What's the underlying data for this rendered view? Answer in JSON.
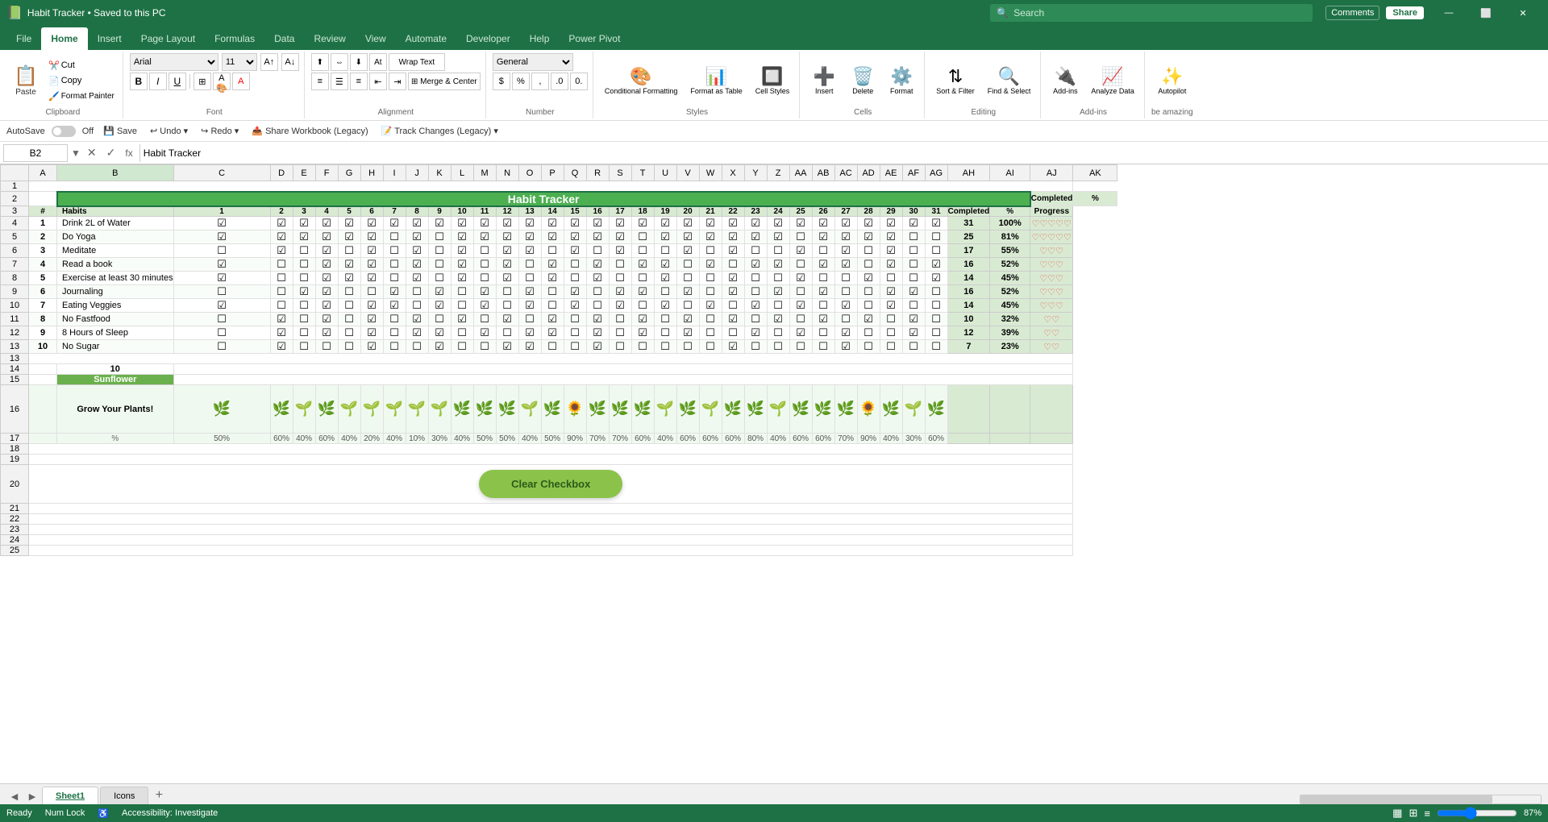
{
  "app": {
    "title": "Habit Tracker • Saved to this PC",
    "icon": "📊"
  },
  "titlebar": {
    "search_placeholder": "Search",
    "minimize": "—",
    "maximize": "⬜",
    "close": "✕",
    "comments": "Comments",
    "share": "Share"
  },
  "ribbon": {
    "tabs": [
      "File",
      "Home",
      "Insert",
      "Page Layout",
      "Formulas",
      "Data",
      "Review",
      "View",
      "Automate",
      "Developer",
      "Help",
      "Power Pivot"
    ],
    "active_tab": "Home",
    "groups": {
      "clipboard": "Clipboard",
      "font": "Font",
      "alignment": "Alignment",
      "number": "Number",
      "styles": "Styles",
      "cells": "Cells",
      "editing": "Editing",
      "addins": "Add-ins",
      "beamazing": "be amazing"
    },
    "buttons": {
      "paste": "Paste",
      "cut": "Cut",
      "copy": "Copy",
      "format_painter": "Format Painter",
      "bold": "B",
      "italic": "I",
      "underline": "U",
      "font_name": "Arial",
      "font_size": "11",
      "wrap_text": "Wrap Text",
      "merge_center": "Merge & Center",
      "conditional_formatting": "Conditional Formatting",
      "format_as_table": "Format as Table",
      "cell_styles": "Cell Styles",
      "insert": "Insert",
      "delete": "Delete",
      "format": "Format",
      "sort_filter": "Sort & Filter",
      "find_select": "Find & Select",
      "add_ins": "Add-ins",
      "analyze_data": "Analyze Data",
      "autopilot": "Autopilot"
    }
  },
  "quick_access": {
    "autosave": "AutoSave",
    "autosave_state": "Off",
    "save": "Save",
    "undo": "Undo",
    "redo": "Redo",
    "share_workbook": "Share Workbook (Legacy)",
    "track_changes": "Track Changes (Legacy)"
  },
  "formula_bar": {
    "cell_ref": "B2",
    "formula": "Habit Tracker"
  },
  "columns": [
    "",
    "A",
    "B",
    "C",
    "D",
    "E",
    "F",
    "G",
    "H",
    "I",
    "J",
    "K",
    "L",
    "M",
    "N",
    "O",
    "P",
    "Q",
    "R",
    "S",
    "T",
    "U",
    "V",
    "W",
    "X",
    "Y",
    "Z",
    "AA",
    "AB",
    "AC",
    "AD",
    "AE",
    "AF",
    "AG",
    "AH",
    "AI",
    "AJ",
    "AK"
  ],
  "tracker": {
    "title": "Habit Tracker",
    "column_headers": [
      "#",
      "Habits",
      "1",
      "2",
      "3",
      "4",
      "5",
      "6",
      "7",
      "8",
      "9",
      "10",
      "11",
      "12",
      "13",
      "14",
      "15",
      "16",
      "17",
      "18",
      "19",
      "20",
      "21",
      "22",
      "23",
      "24",
      "25",
      "26",
      "27",
      "28",
      "29",
      "30",
      "31",
      "Completed",
      "%",
      "Progress"
    ],
    "habits": [
      {
        "num": "1",
        "name": "Drink 2L of Water",
        "days": [
          1,
          1,
          1,
          1,
          1,
          1,
          1,
          1,
          1,
          1,
          1,
          1,
          1,
          1,
          1,
          1,
          1,
          1,
          1,
          1,
          1,
          1,
          1,
          1,
          1,
          1,
          1,
          1,
          1,
          1,
          1
        ],
        "completed": 31,
        "percent": "100%",
        "progress": "♡♡♡♡♡"
      },
      {
        "num": "2",
        "name": "Do Yoga",
        "days": [
          1,
          1,
          1,
          1,
          1,
          1,
          0,
          1,
          0,
          1,
          1,
          1,
          1,
          1,
          1,
          1,
          1,
          0,
          1,
          1,
          1,
          1,
          1,
          1,
          0,
          1,
          1,
          1,
          1,
          0,
          0
        ],
        "completed": 25,
        "percent": "81%",
        "progress": "♡♡♡♡♡"
      },
      {
        "num": "3",
        "name": "Meditate",
        "days": [
          0,
          1,
          0,
          1,
          0,
          1,
          0,
          1,
          0,
          1,
          0,
          1,
          1,
          0,
          1,
          0,
          1,
          0,
          0,
          1,
          0,
          1,
          0,
          0,
          1,
          0,
          1,
          0,
          1,
          0,
          0
        ],
        "completed": 17,
        "percent": "55%",
        "progress": "♡♡♡"
      },
      {
        "num": "4",
        "name": "Read a book",
        "days": [
          1,
          0,
          0,
          1,
          1,
          1,
          0,
          1,
          0,
          1,
          0,
          1,
          0,
          1,
          0,
          1,
          0,
          1,
          1,
          0,
          1,
          0,
          1,
          1,
          0,
          1,
          1,
          0,
          1,
          0,
          1
        ],
        "completed": 16,
        "percent": "52%",
        "progress": "♡♡♡"
      },
      {
        "num": "5",
        "name": "Exercise at least 30 minutes",
        "days": [
          1,
          0,
          0,
          1,
          1,
          1,
          0,
          1,
          0,
          1,
          0,
          1,
          0,
          1,
          0,
          1,
          0,
          0,
          1,
          0,
          0,
          1,
          0,
          0,
          1,
          0,
          0,
          1,
          0,
          0,
          1
        ],
        "completed": 14,
        "percent": "45%",
        "progress": "♡♡♡"
      },
      {
        "num": "6",
        "name": "Journaling",
        "days": [
          0,
          0,
          1,
          1,
          0,
          0,
          1,
          0,
          1,
          0,
          1,
          0,
          1,
          0,
          1,
          0,
          1,
          1,
          0,
          1,
          0,
          1,
          0,
          1,
          0,
          1,
          0,
          0,
          1,
          1,
          0
        ],
        "completed": 16,
        "percent": "52%",
        "progress": "♡♡♡"
      },
      {
        "num": "7",
        "name": "Eating Veggies",
        "days": [
          1,
          0,
          0,
          1,
          0,
          1,
          1,
          0,
          1,
          0,
          1,
          0,
          1,
          0,
          1,
          0,
          1,
          0,
          1,
          0,
          1,
          0,
          1,
          0,
          1,
          0,
          1,
          0,
          1,
          0,
          0
        ],
        "completed": 14,
        "percent": "45%",
        "progress": "♡♡♡"
      },
      {
        "num": "8",
        "name": "No Fastfood",
        "days": [
          0,
          1,
          0,
          1,
          0,
          1,
          0,
          1,
          0,
          1,
          0,
          1,
          0,
          1,
          0,
          1,
          0,
          1,
          0,
          1,
          0,
          1,
          0,
          1,
          0,
          1,
          0,
          1,
          0,
          1,
          0
        ],
        "completed": 10,
        "percent": "32%",
        "progress": "♡♡"
      },
      {
        "num": "9",
        "name": "8 Hours of Sleep",
        "days": [
          0,
          1,
          0,
          1,
          0,
          1,
          0,
          1,
          1,
          0,
          1,
          0,
          1,
          1,
          0,
          1,
          0,
          1,
          0,
          1,
          0,
          0,
          1,
          0,
          1,
          0,
          1,
          0,
          0,
          1,
          0
        ],
        "completed": 12,
        "percent": "39%",
        "progress": "♡♡"
      },
      {
        "num": "10",
        "name": "No Sugar",
        "days": [
          0,
          1,
          0,
          0,
          0,
          1,
          0,
          0,
          1,
          0,
          0,
          1,
          1,
          0,
          0,
          1,
          0,
          0,
          0,
          0,
          0,
          1,
          0,
          0,
          0,
          0,
          1,
          0,
          0,
          0,
          0
        ],
        "completed": 7,
        "percent": "23%",
        "progress": "♡♡"
      }
    ],
    "row14_value": "10",
    "sunflower_label": "Sunflower",
    "grow_label": "Grow Your Plants!",
    "percentages": [
      "50%",
      "60%",
      "40%",
      "60%",
      "40%",
      "20%",
      "40%",
      "10%",
      "30%",
      "40%",
      "50%",
      "50%",
      "40%",
      "50%",
      "90%",
      "70%",
      "70%",
      "60%",
      "40%",
      "60%",
      "60%",
      "60%",
      "80%",
      "40%",
      "60%",
      "60%",
      "70%",
      "90%",
      "40%",
      "30%",
      "60%"
    ],
    "clear_btn": "Clear Checkbox"
  },
  "status": {
    "ready": "Ready",
    "num_lock": "Num Lock",
    "accessibility": "Accessibility: Investigate",
    "zoom": "87%"
  },
  "sheets": [
    "Sheet1",
    "Icons"
  ]
}
